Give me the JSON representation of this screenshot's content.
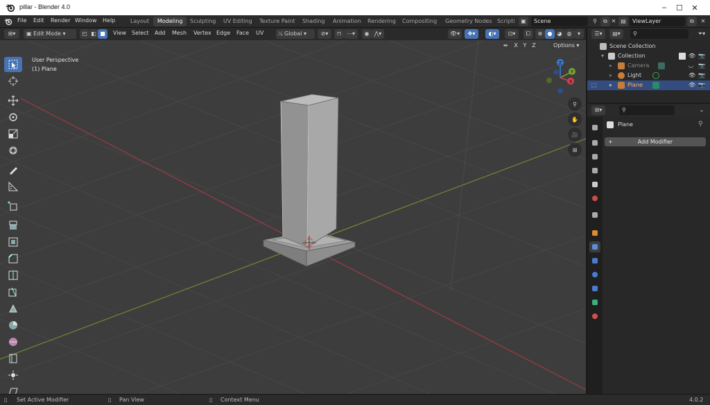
{
  "window": {
    "title": "pillar - Blender 4.0",
    "minimize": "–",
    "maximize": "☐",
    "close": "✕"
  },
  "menu": [
    "File",
    "Edit",
    "Render",
    "Window",
    "Help"
  ],
  "workspaces": [
    "Layout",
    "Modeling",
    "Sculpting",
    "UV Editing",
    "Texture Paint",
    "Shading",
    "Animation",
    "Rendering",
    "Compositing",
    "Geometry Nodes",
    "Scripti"
  ],
  "active_workspace": "Modeling",
  "scene": {
    "name": "Scene"
  },
  "view_layer": {
    "name": "ViewLayer"
  },
  "viewport_header": {
    "mode": "Edit Mode",
    "menus": [
      "View",
      "Select",
      "Add",
      "Mesh",
      "Vertex",
      "Edge",
      "Face",
      "UV"
    ],
    "transform_orientation": "Global"
  },
  "viewport": {
    "perspective": "User Perspective",
    "object_label": "(1) Plane",
    "axis_toggles": [
      "X",
      "Y",
      "Z"
    ],
    "options_label": "Options",
    "gizmo": {
      "z": "Z",
      "y": "Y",
      "x": "X"
    }
  },
  "outliner": {
    "root": "Scene Collection",
    "items": [
      {
        "name": "Collection",
        "depth": 1
      },
      {
        "name": "Camera",
        "depth": 2
      },
      {
        "name": "Light",
        "depth": 2
      },
      {
        "name": "Plane",
        "depth": 2,
        "selected": true
      }
    ]
  },
  "properties": {
    "object_name": "Plane",
    "add_modifier": "Add Modifier"
  },
  "statusbar": {
    "left": "Set Active Modifier",
    "middle": "Pan View",
    "right": "Context Menu",
    "version": "4.0.2"
  },
  "colors": {
    "accent": "#4772b3",
    "selected_row": "#334d80",
    "x_axis": "#d04050",
    "y_axis": "#7aa030",
    "z_axis": "#3a7ad0"
  }
}
